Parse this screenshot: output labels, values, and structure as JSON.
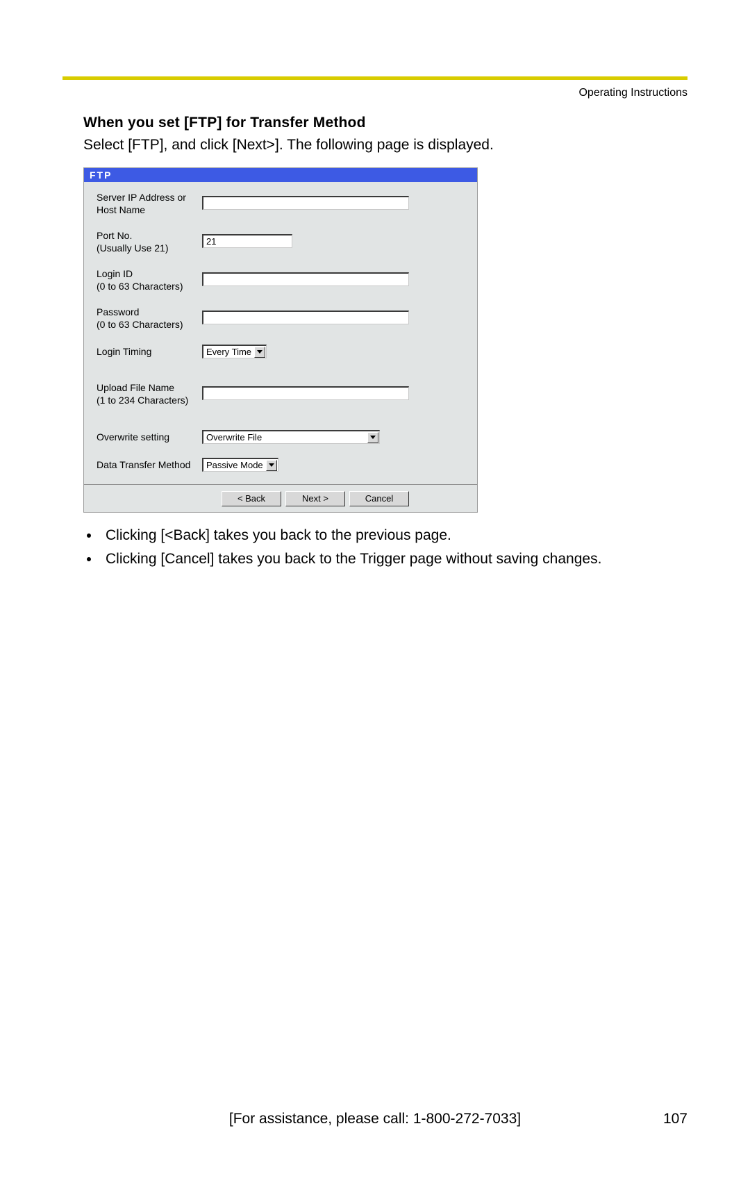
{
  "header_label": "Operating Instructions",
  "section_title": "When you set [FTP] for Transfer Method",
  "section_subtext": "Select [FTP], and click [Next>]. The following page is displayed.",
  "ftp": {
    "panel_title": "FTP",
    "rows": {
      "server": {
        "label": "Server IP Address or Host Name",
        "value": ""
      },
      "port": {
        "label": "Port No.\n(Usually Use 21)",
        "value": "21"
      },
      "login": {
        "label": "Login ID\n(0 to 63 Characters)",
        "value": ""
      },
      "password": {
        "label": "Password\n(0 to 63 Characters)",
        "value": ""
      },
      "login_timing": {
        "label": "Login Timing",
        "value": "Every Time"
      },
      "upload_file": {
        "label": "Upload File Name\n(1 to 234 Characters)",
        "value": ""
      },
      "overwrite": {
        "label": "Overwrite setting",
        "value": "Overwrite File"
      },
      "data_method": {
        "label": "Data Transfer Method",
        "value": "Passive Mode"
      }
    },
    "buttons": {
      "back": "< Back",
      "next": "Next >",
      "cancel": "Cancel"
    }
  },
  "bullets": [
    "Clicking [<Back] takes you back to the previous page.",
    "Clicking [Cancel] takes you back to the Trigger page without saving changes."
  ],
  "footer_assistance": "[For assistance, please call: 1-800-272-7033]",
  "page_number": "107"
}
